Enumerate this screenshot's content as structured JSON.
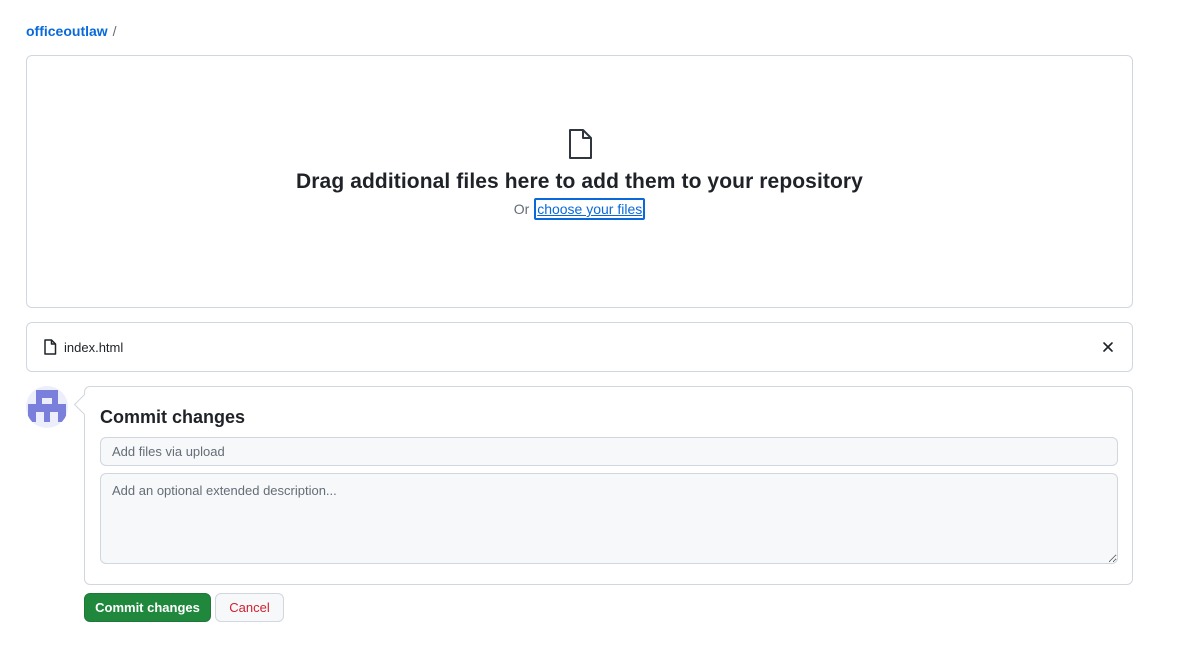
{
  "breadcrumb": {
    "owner": "officeoutlaw",
    "separator": "/"
  },
  "dropzone": {
    "icon": "file-icon",
    "title": "Drag additional files here to add them to your repository",
    "prefix": "Or",
    "link_label": "choose your files"
  },
  "files": [
    {
      "icon": "file-icon",
      "name": "index.html",
      "remove_icon": "close-icon"
    }
  ],
  "commit": {
    "title": "Commit changes",
    "summary_placeholder": "Add files via upload",
    "summary_value": "",
    "description_placeholder": "Add an optional extended description...",
    "description_value": "",
    "commit_button_label": "Commit changes",
    "cancel_button_label": "Cancel"
  },
  "avatar": {
    "icon": "identicon",
    "color": "#7b7fdc"
  },
  "colors": {
    "link": "#0969da",
    "primary_button": "#1f883d",
    "danger_text": "#cf222e",
    "border": "#d0d7de",
    "input_bg": "#f6f8fa"
  }
}
